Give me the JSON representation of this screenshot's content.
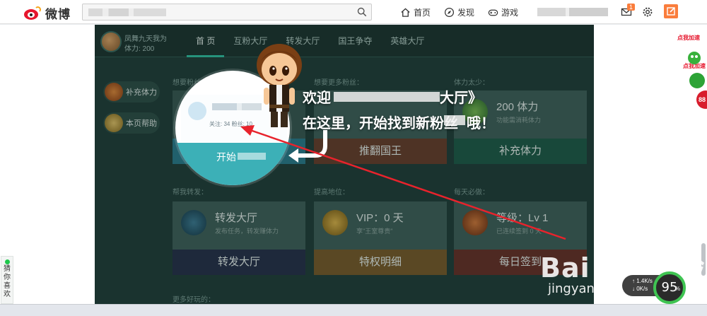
{
  "topbar": {
    "logo_text": "微博",
    "nav": [
      {
        "label": "首页",
        "icon": "home-icon"
      },
      {
        "label": "发现",
        "icon": "compass-icon"
      },
      {
        "label": "游戏",
        "icon": "gamepad-icon"
      }
    ],
    "mail_badge": "1",
    "accent": "#fa7d3c"
  },
  "game": {
    "player": {
      "name": "凤舞九天我为",
      "stamina": "体力: 200"
    },
    "tabs": [
      "首 页",
      "互粉大厅",
      "转发大厅",
      "国王争夺",
      "英雄大厅"
    ],
    "active_tab": "首 页",
    "side_buttons": [
      "补充体力",
      "本页帮助"
    ],
    "sections": {
      "fans_label": "想要粉丝：",
      "more_fans_label": "想要更多粉丝：",
      "stamina_low_label": "体力太少：",
      "repost_label": "帮我转发：",
      "status_label": "提高地位：",
      "daily_label": "每天必做：",
      "more_label": "更多好玩的："
    },
    "cards": [
      {
        "title": "",
        "subtitle": "",
        "button": "推翻国王"
      },
      {
        "title": "200 体力",
        "subtitle": "功能需消耗体力",
        "button": "补充体力"
      },
      {
        "title": "转发大厅",
        "subtitle": "发布任务，转发赚体力",
        "button": "转发大厅"
      },
      {
        "title": "VIP：0 天",
        "subtitle": "享\"王室尊贵\"",
        "button": "特权明细"
      },
      {
        "title": "等级：Lv 1",
        "subtitle": "已连续签到 0 天",
        "button": "每日签到"
      }
    ],
    "spotlight": {
      "stats": "关注: 34 粉丝: 10",
      "button": "开始"
    }
  },
  "tutorial": {
    "line1": "欢迎",
    "line1_end": "大厅》",
    "line2": "在这里，开始找到新粉丝",
    "line2_end": "哦！"
  },
  "right_ads": [
    "点我加速",
    "点我加速"
  ],
  "red_ball_text": "88",
  "guess": "猜你喜欢",
  "speed": {
    "up": "↑ 1.4K/s",
    "down": "↓ 0K/s",
    "value": "95",
    "unit": "%"
  },
  "watermark": {
    "brand": "Bai du 经验",
    "url": "jingyan.baidu.com"
  }
}
